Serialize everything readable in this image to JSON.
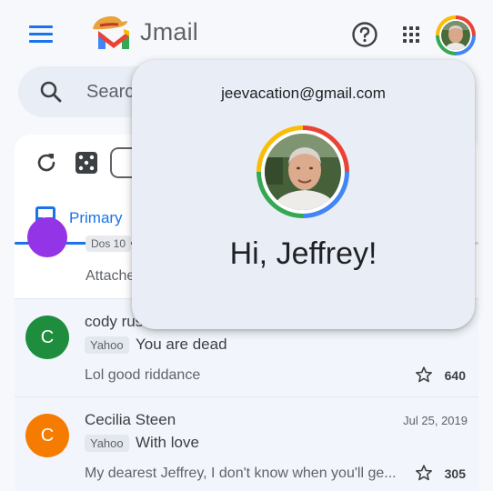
{
  "app": {
    "brand": "Jmail"
  },
  "search": {
    "placeholder": "Search in mail"
  },
  "tabs": {
    "primary_label": "Primary"
  },
  "emails": [
    {
      "snippet": "Attached"
    },
    {
      "sender": "cody rush",
      "initial": "C",
      "avatar_color": "#1e8e3e",
      "tag": "Yahoo",
      "subject": "You are dead",
      "snippet": "Lol good riddance",
      "count": "640"
    },
    {
      "sender": "Cecilia Steen",
      "initial": "C",
      "avatar_color": "#f57c00",
      "tag": "Yahoo",
      "subject": "With love",
      "date": "Jul 25, 2019",
      "snippet": "My dearest Jeffrey, I don't know when you'll ge...",
      "count": "305"
    }
  ],
  "account_popup": {
    "email": "jeevacation@gmail.com",
    "greeting": "Hi, Jeffrey!"
  },
  "colors": {
    "accent": "#1a73e8",
    "surface": "#f6f8fc",
    "popup_bg": "#e9eef6"
  }
}
